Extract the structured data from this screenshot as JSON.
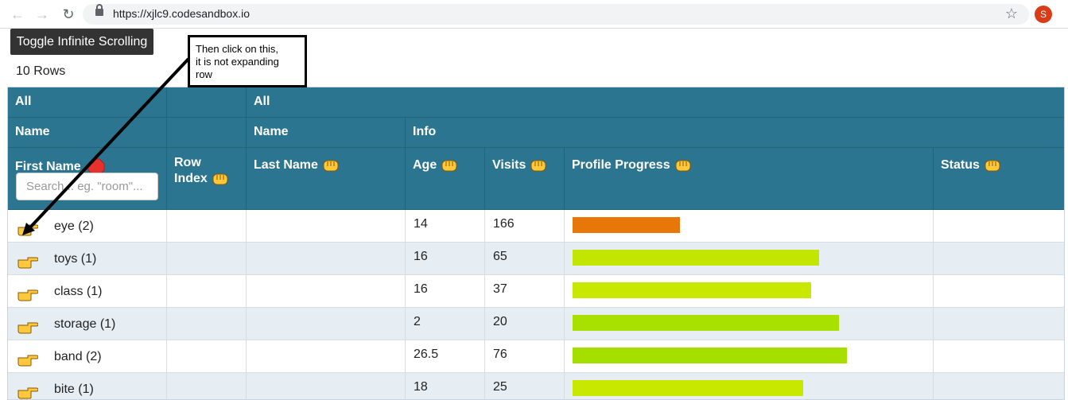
{
  "browser": {
    "url": "https://xjlc9.codesandbox.io",
    "profile_initial": "S"
  },
  "toolbar": {
    "toggle_label": "Toggle Infinite Scrolling",
    "rows_label": "10 Rows"
  },
  "callout": {
    "lines": [
      "Then click on this,",
      "it is not expanding",
      "row"
    ]
  },
  "table": {
    "group_row1": {
      "left": "All",
      "right": "All"
    },
    "group_row2": {
      "name_left": "Name",
      "name_right": "Name",
      "info": "Info"
    },
    "columns": {
      "first_name": "First Name",
      "row_index_1": "Row",
      "row_index_2": "Index",
      "last_name": "Last Name",
      "age": "Age",
      "visits": "Visits",
      "profile_progress": "Profile Progress",
      "status": "Status"
    },
    "search_placeholder": "Search... eg. \"room\"...",
    "rows": [
      {
        "name": "eye (2)",
        "age": "14",
        "visits": "166",
        "progress": 0.27,
        "color": "#e8770a"
      },
      {
        "name": "toys (1)",
        "age": "16",
        "visits": "65",
        "progress": 0.62,
        "color": "#c2e600"
      },
      {
        "name": "class (1)",
        "age": "16",
        "visits": "37",
        "progress": 0.6,
        "color": "#c8e800"
      },
      {
        "name": "storage (1)",
        "age": "2",
        "visits": "20",
        "progress": 0.67,
        "color": "#a8e000"
      },
      {
        "name": "band (2)",
        "age": "26.5",
        "visits": "76",
        "progress": 0.69,
        "color": "#a4df00"
      },
      {
        "name": "bite (1)",
        "age": "18",
        "visits": "25",
        "progress": 0.58,
        "color": "#c9e800"
      }
    ]
  }
}
